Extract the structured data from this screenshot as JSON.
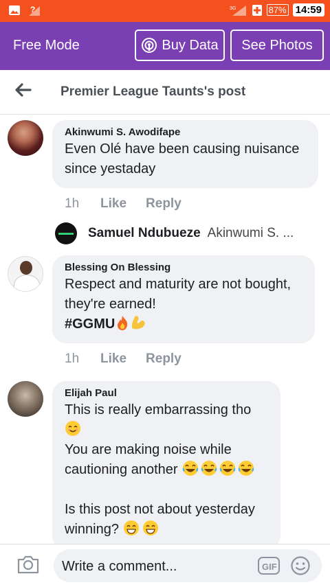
{
  "status_bar": {
    "battery": "87%",
    "time": "14:59"
  },
  "top_bar": {
    "mode_label": "Free Mode",
    "buy_data_label": "Buy Data",
    "see_photos_label": "See Photos",
    "color": "#7b3fb4"
  },
  "header": {
    "title": "Premier League Taunts's post"
  },
  "comments": [
    {
      "author": "Akinwumi S. Awodifape",
      "text": "Even Olé have been causing nuisance since yestaday",
      "time": "1h",
      "like": "Like",
      "reply": "Reply"
    },
    {
      "author": "Blessing On Blessing",
      "line1": "Respect and maturity are not bought, they're earned!",
      "hashtag": "#GGMU",
      "time": "1h",
      "like": "Like",
      "reply": "Reply"
    },
    {
      "author": "Elijah Paul",
      "line1": "This is really embarrassing tho",
      "line2": "You are making noise while cautioning another",
      "line3": "Is this post not about yesterday winning?"
    }
  ],
  "reply_preview": {
    "name": "Samuel Ndubueze",
    "text": "Akinwumi S. ..."
  },
  "composer": {
    "placeholder": "Write a comment..."
  }
}
